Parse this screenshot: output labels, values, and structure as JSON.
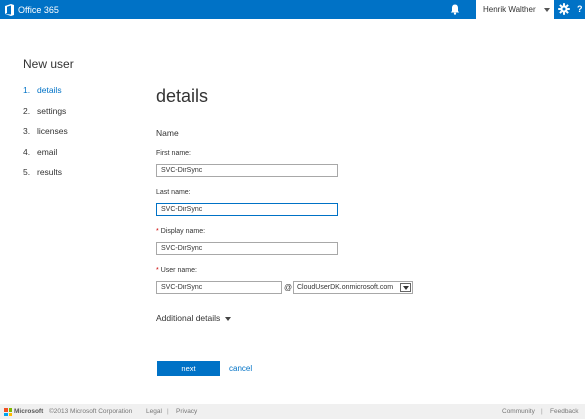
{
  "topbar": {
    "app_name": "Office 365",
    "user_name": "Henrik Walther",
    "help_glyph": "?",
    "accent_color": "#0072c6"
  },
  "wizard": {
    "title": "New user",
    "steps": [
      {
        "num": "1.",
        "label": "details",
        "active": true
      },
      {
        "num": "2.",
        "label": "settings",
        "active": false
      },
      {
        "num": "3.",
        "label": "licenses",
        "active": false
      },
      {
        "num": "4.",
        "label": "email",
        "active": false
      },
      {
        "num": "5.",
        "label": "results",
        "active": false
      }
    ]
  },
  "form": {
    "section_title": "details",
    "group_label": "Name",
    "required_mark": "*",
    "first_name": {
      "label": "First name:",
      "value": "SVC-DirSync"
    },
    "last_name": {
      "label": "Last name:",
      "value": "SVC-DirSync"
    },
    "display_name": {
      "label": "Display name:",
      "value": "SVC-DirSync"
    },
    "user_name": {
      "label": "User name:",
      "value": "SVC-DirSync"
    },
    "at_sign": "@",
    "domain": "CloudUserDK.onmicrosoft.com",
    "additional_details": "Additional details",
    "next_label": "next",
    "cancel_label": "cancel"
  },
  "footer": {
    "brand": "Microsoft",
    "copyright": "©2013 Microsoft Corporation",
    "legal": "Legal",
    "privacy": "Privacy",
    "community": "Community",
    "feedback": "Feedback",
    "separator": "|"
  }
}
